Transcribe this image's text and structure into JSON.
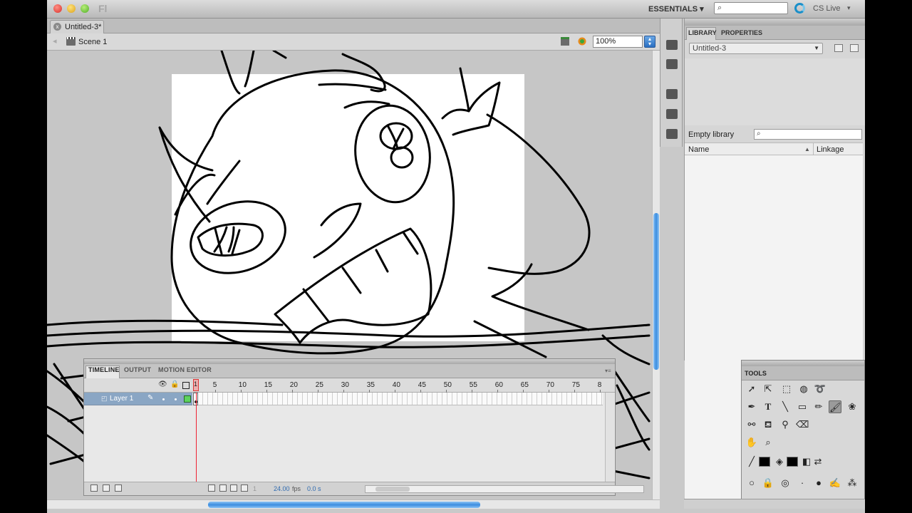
{
  "app": {
    "logo_text": "Fl"
  },
  "topbar": {
    "workspace_label": "ESSENTIALS ▾",
    "search_icon": "magnifier-icon",
    "cs_live_label": "CS Live",
    "cs_live_dropdown": "▾"
  },
  "document": {
    "tab_label": "Untitled-3*",
    "close_symbol": "x"
  },
  "editbar": {
    "back_symbol": "◂",
    "scene_label": "Scene 1",
    "zoom_value": "100%"
  },
  "timeline": {
    "tabs": [
      "TIMELINE",
      "OUTPUT",
      "MOTION EDITOR"
    ],
    "menu_symbol": "▾≡",
    "header_icons": [
      "eye-icon",
      "lock-icon",
      "outline-icon"
    ],
    "ruler_labels": [
      "1",
      "5",
      "10",
      "15",
      "20",
      "25",
      "30",
      "35",
      "40",
      "45",
      "50",
      "55",
      "60",
      "65",
      "70",
      "75",
      "8"
    ],
    "playhead_frame": "1",
    "layers": [
      {
        "name": "Layer 1"
      }
    ],
    "footer": {
      "frame": "1",
      "fps": "24.00",
      "fps_unit": "fps",
      "time": "0.0 s"
    }
  },
  "library": {
    "tabs": [
      "LIBRARY",
      "PROPERTIES"
    ],
    "document_select": "Untitled-3",
    "status": "Empty library",
    "columns": {
      "name": "Name",
      "linkage": "Linkage"
    }
  },
  "tools": {
    "title": "TOOLS",
    "selected_tool": "brush-tool-icon",
    "stroke_color": "#000000",
    "fill_color": "#000000"
  },
  "colors": {
    "accent": "#3b8de0",
    "layer_highlight": "#8aa6c4",
    "playhead": "#e22233"
  }
}
